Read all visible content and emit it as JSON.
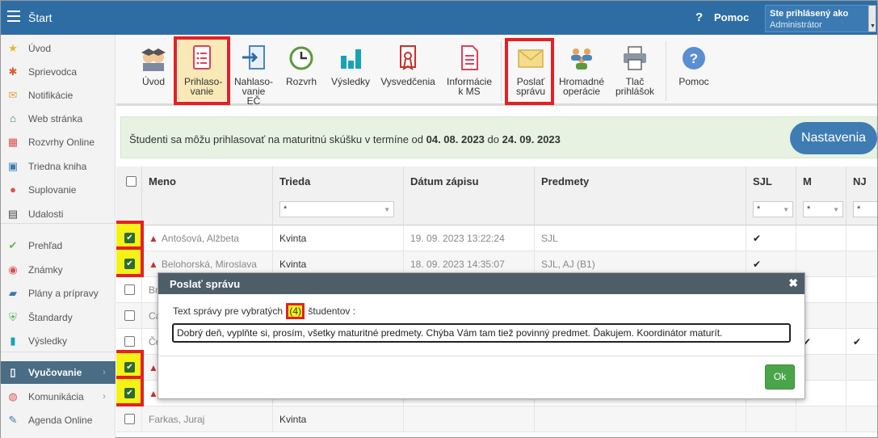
{
  "header": {
    "title": "Štart",
    "help_label": "Pomoc",
    "user_label": "Ste prihlásený ako",
    "user_role": "Administrátor",
    "color": "#2e6da4"
  },
  "sidebar": {
    "items": [
      {
        "label": "Úvod",
        "icon": "star-icon"
      },
      {
        "label": "Sprievodca",
        "icon": "wand-icon"
      },
      {
        "label": "Notifikácie",
        "icon": "envelope-icon"
      },
      {
        "label": "Web stránka",
        "icon": "home-icon"
      },
      {
        "label": "Rozvrhy Online",
        "icon": "calendar-grid-icon"
      },
      {
        "label": "Triedna kniha",
        "icon": "book-icon"
      },
      {
        "label": "Suplovanie",
        "icon": "user-icon"
      },
      {
        "label": "Udalosti",
        "icon": "calendar-icon"
      },
      {
        "label": "Prehľad",
        "icon": "check-circle-icon"
      },
      {
        "label": "Známky",
        "icon": "grade-icon"
      },
      {
        "label": "Plány a prípravy",
        "icon": "briefcase-icon"
      },
      {
        "label": "Štandardy",
        "icon": "shield-icon"
      },
      {
        "label": "Výsledky",
        "icon": "bar-chart-icon"
      },
      {
        "label": "Vyučovanie",
        "icon": "open-book-icon"
      },
      {
        "label": "Komunikácia",
        "icon": "chat-icon"
      },
      {
        "label": "Agenda Online",
        "icon": "pencil-icon"
      }
    ]
  },
  "toolbar": {
    "items": [
      {
        "label": "Úvod",
        "icon": "students-icon"
      },
      {
        "label": "Prihlaso-vanie",
        "icon": "form-icon"
      },
      {
        "label": "Nahlaso-vanie EČ",
        "icon": "arrow-in-icon"
      },
      {
        "label": "Rozvrh",
        "icon": "clock-icon"
      },
      {
        "label": "Výsledky",
        "icon": "bar-chart-icon"
      },
      {
        "label": "Vysvedčenia",
        "icon": "certificate-icon"
      },
      {
        "label": "Informácie k MS",
        "icon": "document-icon"
      },
      {
        "label": "Poslať správu",
        "icon": "envelope-icon"
      },
      {
        "label": "Hromadné operácie",
        "icon": "group-icon"
      },
      {
        "label": "Tlač prihlášok",
        "icon": "printer-icon"
      },
      {
        "label": "Pomoc",
        "icon": "help-icon"
      }
    ]
  },
  "banner": {
    "text_before": "Študenti sa môžu prihlasovať na maturitnú skúšku v termíne od ",
    "date_from": "04. 08. 2023",
    "text_mid": " do ",
    "date_to": "24. 09. 2023",
    "settings_label": "Nastavenia"
  },
  "table": {
    "columns": [
      "Meno",
      "Trieda",
      "Dátum zápisu",
      "Predmety",
      "SJL",
      "M",
      "NJ"
    ],
    "filters": {
      "trieda": "*",
      "sjl": "*",
      "m": "*",
      "nj": "*"
    },
    "rows": [
      {
        "name": "Antošová, Alžbeta",
        "class": "Kvinta",
        "date": "19. 09. 2023 13:22:24",
        "subjects": "SJL",
        "sjl": "✔",
        "m": "",
        "nj": "",
        "checked": true,
        "warn": true
      },
      {
        "name": "Belohorská, Miroslava",
        "class": "Kvinta",
        "date": "18. 09. 2023 14:35:07",
        "subjects": "SJL, AJ (B1)",
        "sjl": "✔",
        "m": "",
        "nj": "",
        "checked": true,
        "warn": true
      },
      {
        "name": "Br",
        "class": "",
        "date": "",
        "subjects": "",
        "sjl": "",
        "m": "",
        "nj": "",
        "checked": false,
        "warn": false
      },
      {
        "name": "Ca",
        "class": "",
        "date": "",
        "subjects": "",
        "sjl": "",
        "m": "",
        "nj": "",
        "checked": false,
        "warn": false
      },
      {
        "name": "Če",
        "class": "",
        "date": "",
        "subjects": "",
        "sjl": "",
        "m": "✔",
        "nj": "✔",
        "checked": false,
        "warn": false
      },
      {
        "name": "",
        "class": "",
        "date": "",
        "subjects": "",
        "sjl": "",
        "m": "",
        "nj": "",
        "checked": true,
        "warn": true
      },
      {
        "name": "",
        "class": "",
        "date": "",
        "subjects": "",
        "sjl": "",
        "m": "",
        "nj": "",
        "checked": true,
        "warn": true
      },
      {
        "name": "Farkas, Juraj",
        "class": "Kvinta",
        "date": "",
        "subjects": "",
        "sjl": "",
        "m": "",
        "nj": "",
        "checked": false,
        "warn": false
      }
    ]
  },
  "dialog": {
    "title": "Poslať správu",
    "close": "✖",
    "prompt_before": "Text správy pre vybratých ",
    "count": "(4)",
    "prompt_after": " študentov :",
    "message": "Dobrý deň, vyplňte si, prosím, všetky maturitné predmety. Chýba Vám tam tiež povinný predmet. Ďakujem. Koordinátor maturít.",
    "ok_label": "Ok"
  }
}
